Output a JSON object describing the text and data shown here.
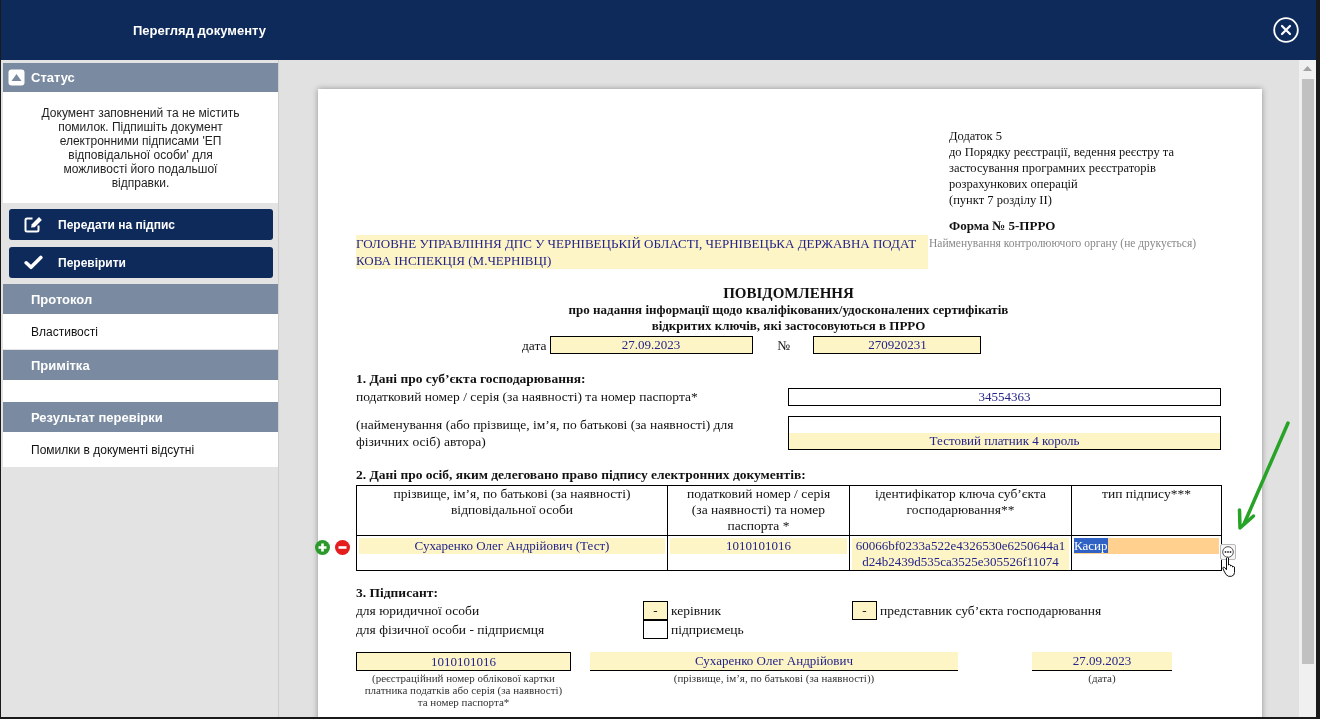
{
  "window": {
    "title": "Перегляд документу"
  },
  "sidebar": {
    "status": {
      "title": "Статус",
      "expanded": true,
      "message": "Документ заповнений та не містить помилок. Підпишіть документ електронними підписами 'ЕП відповідальної особи' для можливості його подальшої відправки."
    },
    "actions": [
      {
        "kind": "edit",
        "label": "Передати на підпис"
      },
      {
        "kind": "check",
        "label": "Перевірити"
      }
    ],
    "sections": [
      {
        "title": "Протокол",
        "items": [
          "Властивості"
        ]
      },
      {
        "title": "Примітка"
      },
      {
        "title": "Результат перевірки",
        "items": [
          "Помилки в документі відсутні"
        ]
      }
    ]
  },
  "document": {
    "annex": [
      "Додаток 5",
      "до Порядку реєстрації, ведення реєстру та",
      "застосування програмних реєстраторів",
      "розрахункових операцій",
      "(пункт 7 розділу II)"
    ],
    "form_number": "Форма № 5-ПРРО",
    "authority": {
      "value": "ГОЛОВНЕ УПРАВЛІННЯ ДПС У ЧЕРНІВЕЦЬКІЙ ОБЛАСТІ, ЧЕРНІВЕЦЬКА ДЕРЖАВНА ПОДАТКОВА ІНСПЕКЦІЯ (М.ЧЕРНІВЦІ)",
      "hint": "Найменування контролюючого органу (не друкується)"
    },
    "title": "ПОВІДОМЛЕННЯ",
    "subtitle": [
      "про надання інформації щодо кваліфікованих/удосконалених сертифікатів",
      "відкритих ключів, які застосовуються в ПРРО"
    ],
    "date": {
      "label": "дата",
      "value": "27.09.2023"
    },
    "number": {
      "label": "№",
      "value": "270920231"
    },
    "section1": {
      "heading": "1. Дані про суб’єкта господарювання:",
      "fields": [
        {
          "label": "податковий номер / серія (за наявності) та номер паспорта*",
          "value": "34554363",
          "highlighted": false
        },
        {
          "label": "(найменування (або прізвище, ім’я, по батькові (за наявності) для фізичних осіб) автора)",
          "value": "Тестовий платник 4 король",
          "highlighted": true
        }
      ]
    },
    "section2": {
      "heading": "2. Дані про осіб, яким делеговано право підпису електронних документів:",
      "table": {
        "columns": [
          "прізвище, ім’я, по батькові (за наявності) відповідальної особи",
          "податковий номер / серія (за наявності) та номер паспорта *",
          "ідентифікатор ключа суб’єкта господарювання**",
          "тип підпису***"
        ],
        "rows": [
          {
            "cells": [
              {
                "value": "Сухаренко Олег Андрійович (Тест)",
                "active": false
              },
              {
                "value": "1010101016",
                "active": false
              },
              {
                "value": "60066bf0233a522e4326530e6250644a1d24b2439d535ca3525e305526f11074",
                "active": false
              },
              {
                "value": "Касир",
                "active": true
              }
            ]
          }
        ]
      }
    },
    "section3": {
      "heading": "3. Підписант:",
      "rows": [
        {
          "label": "для юридичної особи",
          "options": [
            {
              "value": "-",
              "label": "керівник"
            },
            {
              "value": "-",
              "label": "представник суб’єкта господарювання"
            }
          ]
        },
        {
          "label": "для фізичної особи - підприємця",
          "options": [
            {
              "label": "підприємець"
            }
          ]
        }
      ]
    },
    "signature": [
      {
        "kind": "boxed",
        "value": "1010101016",
        "caption": "(реєстраційний номер облікової картки платника податків або серія (за наявності) та номер паспорта*"
      },
      {
        "kind": "underlined",
        "value": "Сухаренко Олег Андрійович",
        "caption": "(прізвище, ім’я, по батькові (за наявності))"
      },
      {
        "kind": "underlined",
        "value": "27.09.2023",
        "caption": "(дата)"
      }
    ]
  }
}
